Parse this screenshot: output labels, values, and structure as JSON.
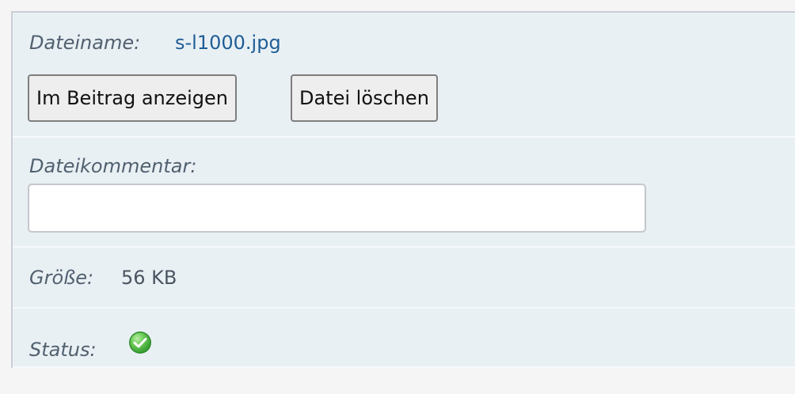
{
  "file": {
    "name_label": "Dateiname:",
    "name_value": "s-l1000.jpg",
    "show_in_post_label": "Im Beitrag anzeigen",
    "delete_label": "Datei löschen",
    "comment_label": "Dateikommentar:",
    "comment_value": "",
    "size_label": "Größe:",
    "size_value": "56 KB",
    "status_label": "Status:",
    "status_icon": "green-check-icon"
  },
  "colors": {
    "panel_bg": "#e9f0f4",
    "filename": "#1f5d96",
    "status_ok": "#56b847"
  }
}
